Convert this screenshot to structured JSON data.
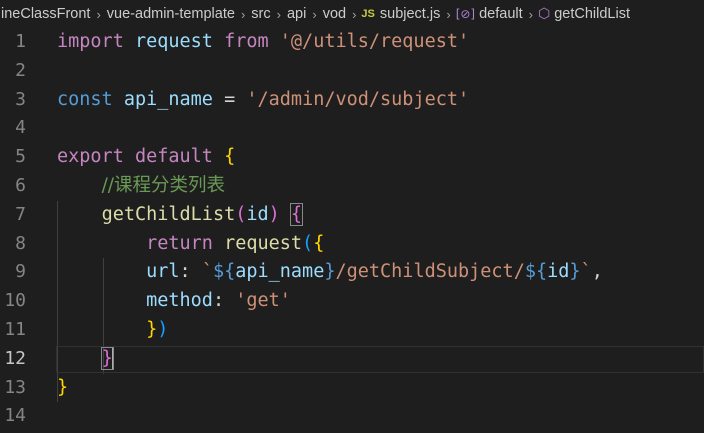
{
  "breadcrumb": {
    "items": [
      "ineClassFront",
      "vue-admin-template",
      "src",
      "api",
      "vod"
    ],
    "file_badge": "JS",
    "file": "subject.js",
    "symbol_default": "default",
    "symbol_method": "getChildList",
    "separator": "›"
  },
  "editor": {
    "current_line": 12,
    "lines": [
      {
        "num": "1",
        "tokens": [
          {
            "t": "import",
            "c": "kw-pink"
          },
          {
            "t": " ",
            "c": ""
          },
          {
            "t": "request",
            "c": "var"
          },
          {
            "t": " ",
            "c": ""
          },
          {
            "t": "from",
            "c": "kw-pink"
          },
          {
            "t": " ",
            "c": ""
          },
          {
            "t": "'@/utils/request'",
            "c": "str"
          }
        ]
      },
      {
        "num": "2",
        "tokens": []
      },
      {
        "num": "3",
        "tokens": [
          {
            "t": "const",
            "c": "kw-blue"
          },
          {
            "t": " ",
            "c": ""
          },
          {
            "t": "api_name",
            "c": "var"
          },
          {
            "t": " = ",
            "c": ""
          },
          {
            "t": "'/admin/vod/subject'",
            "c": "str"
          }
        ]
      },
      {
        "num": "4",
        "tokens": []
      },
      {
        "num": "5",
        "tokens": [
          {
            "t": "export",
            "c": "kw-pink"
          },
          {
            "t": " ",
            "c": ""
          },
          {
            "t": "default",
            "c": "kw-pink"
          },
          {
            "t": " ",
            "c": ""
          },
          {
            "t": "{",
            "c": "br-y"
          }
        ]
      },
      {
        "num": "6",
        "tokens": [
          {
            "t": "    ",
            "c": ""
          },
          {
            "t": "//课程分类列表",
            "c": "cm"
          }
        ]
      },
      {
        "num": "7",
        "tokens": [
          {
            "t": "    ",
            "c": ""
          },
          {
            "t": "getChildList",
            "c": "fn"
          },
          {
            "t": "(",
            "c": "br-p"
          },
          {
            "t": "id",
            "c": "var"
          },
          {
            "t": ")",
            "c": "br-p"
          },
          {
            "t": " ",
            "c": ""
          },
          {
            "t": "{",
            "c": "br-p match"
          }
        ]
      },
      {
        "num": "8",
        "tokens": [
          {
            "t": "        ",
            "c": ""
          },
          {
            "t": "return",
            "c": "kw-pink"
          },
          {
            "t": " ",
            "c": ""
          },
          {
            "t": "request",
            "c": "fn"
          },
          {
            "t": "(",
            "c": "br-b"
          },
          {
            "t": "{",
            "c": "br-y"
          }
        ]
      },
      {
        "num": "9",
        "tokens": [
          {
            "t": "        ",
            "c": ""
          },
          {
            "t": "url",
            "c": "var"
          },
          {
            "t": ": ",
            "c": ""
          },
          {
            "t": "`",
            "c": "str"
          },
          {
            "t": "${",
            "c": "kw-blue"
          },
          {
            "t": "api_name",
            "c": "var"
          },
          {
            "t": "}",
            "c": "kw-blue"
          },
          {
            "t": "/getChildSubject/",
            "c": "str"
          },
          {
            "t": "${",
            "c": "kw-blue"
          },
          {
            "t": "id",
            "c": "var"
          },
          {
            "t": "}",
            "c": "kw-blue"
          },
          {
            "t": "`",
            "c": "str"
          },
          {
            "t": ",",
            "c": ""
          }
        ]
      },
      {
        "num": "10",
        "tokens": [
          {
            "t": "        ",
            "c": ""
          },
          {
            "t": "method",
            "c": "var"
          },
          {
            "t": ": ",
            "c": ""
          },
          {
            "t": "'get'",
            "c": "str"
          }
        ]
      },
      {
        "num": "11",
        "tokens": [
          {
            "t": "        ",
            "c": ""
          },
          {
            "t": "}",
            "c": "br-y"
          },
          {
            "t": ")",
            "c": "br-b"
          }
        ]
      },
      {
        "num": "12",
        "tokens": [
          {
            "t": "    ",
            "c": ""
          },
          {
            "t": "}",
            "c": "br-p match"
          },
          {
            "t": "",
            "c": "cursor"
          }
        ]
      },
      {
        "num": "13",
        "tokens": [
          {
            "t": "}",
            "c": "br-y"
          }
        ]
      },
      {
        "num": "14",
        "tokens": []
      }
    ]
  }
}
